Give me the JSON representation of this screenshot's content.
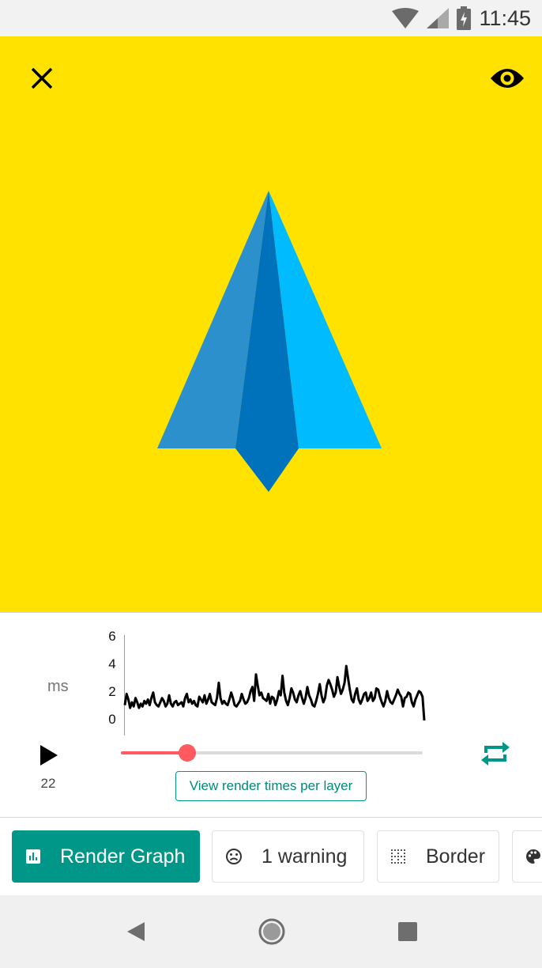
{
  "status_bar": {
    "time": "11:45"
  },
  "colors": {
    "canvas_bg": "#FFE200",
    "arrow_left": "#2B90CC",
    "arrow_center": "#0071BB",
    "arrow_right": "#00BCFF",
    "accent": "#009688",
    "slider_active": "#FF5A5F"
  },
  "canvas": {
    "close_icon": "close-icon",
    "visibility_icon": "eye-icon"
  },
  "render_graph": {
    "unit_label": "ms",
    "y_ticks": [
      "6",
      "4",
      "2",
      "0"
    ],
    "frame_number": "22",
    "play_icon": "play-icon",
    "loop_icon": "repeat-icon",
    "slider_progress": 0.22,
    "layer_button": "View render times per layer"
  },
  "chart_data": {
    "type": "line",
    "ylabel": "ms",
    "ylim": [
      0,
      6
    ],
    "yticks": [
      0,
      2,
      4,
      6
    ],
    "series": [
      {
        "values": [
          1.1,
          1.9,
          1.5,
          0.9,
          1.3,
          1.0,
          1.6,
          1.3,
          0.9,
          1.2,
          1.0,
          1.4,
          1.2,
          1.5,
          1.1,
          1.6,
          2.0,
          1.3,
          1.1,
          1.0,
          1.3,
          1.6,
          1.4,
          1.0,
          1.2,
          1.8,
          1.2,
          1.0,
          1.3,
          1.4,
          1.1,
          1.2,
          1.3,
          1.0,
          1.6,
          1.9,
          1.3,
          1.5,
          1.2,
          1.4,
          1.1,
          1.0,
          1.7,
          1.5,
          1.3,
          1.8,
          1.2,
          1.5,
          1.9,
          1.3,
          1.2,
          1.1,
          1.6,
          2.7,
          1.6,
          1.2,
          1.4,
          1.2,
          1.1,
          1.5,
          2.0,
          1.6,
          1.1,
          1.0,
          1.2,
          1.4,
          1.9,
          1.5,
          1.2,
          1.3,
          1.6,
          2.1,
          2.4,
          1.4,
          3.3,
          2.5,
          1.8,
          2.0,
          1.6,
          1.5,
          1.4,
          1.9,
          1.2,
          1.7,
          1.6,
          1.1,
          1.5,
          2.1,
          1.8,
          3.2,
          2.0,
          1.4,
          1.1,
          1.6,
          2.3,
          2.0,
          1.5,
          1.3,
          1.8,
          2.1,
          1.6,
          1.2,
          1.6,
          2.4,
          1.8,
          1.5,
          1.1,
          1.0,
          1.4,
          1.9,
          2.6,
          1.8,
          1.3,
          1.6,
          2.5,
          2.9,
          2.6,
          2.2,
          1.7,
          2.0,
          3.1,
          2.4,
          1.9,
          2.2,
          2.7,
          3.9,
          3.0,
          2.2,
          1.5,
          1.3,
          1.9,
          2.3,
          1.5,
          1.2,
          1.5,
          1.9,
          2.0,
          1.4,
          1.6,
          2.0,
          1.4,
          1.6,
          2.3,
          2.2,
          1.7,
          1.3,
          1.0,
          1.4,
          2.1,
          1.6,
          1.3,
          1.2,
          1.5,
          1.8,
          2.2,
          1.9,
          1.7,
          1.0,
          1.6,
          1.7,
          2.0,
          1.9,
          1.3,
          1.0,
          1.5,
          1.8,
          2.1,
          2.0,
          1.7,
          0.0
        ]
      }
    ]
  },
  "chips": [
    {
      "icon": "bar-chart-icon",
      "label": "Render Graph"
    },
    {
      "icon": "sad-face-icon",
      "label": "1 warning"
    },
    {
      "icon": "dotted-border-icon",
      "label": "Border"
    },
    {
      "icon": "palette-icon",
      "label": ""
    }
  ],
  "nav_bar": {
    "back": "back-icon",
    "home": "home-icon",
    "recents": "recents-icon"
  }
}
